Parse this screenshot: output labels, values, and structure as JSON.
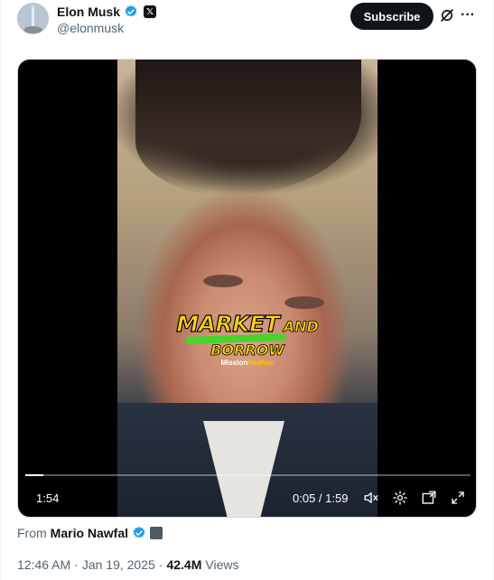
{
  "author": {
    "display_name": "Elon Musk",
    "handle": "@elonmusk",
    "x_badge": "𝕏"
  },
  "header": {
    "subscribe_label": "Subscribe",
    "more_label": "···"
  },
  "video": {
    "caption_word1": "MARKET",
    "caption_word2": "AND",
    "caption_word3": "BORROW",
    "watermark_part1": "Mission",
    "watermark_part2": "Radhne",
    "elapsed_badge": "1:54",
    "time_display": "0:05 / 1:59",
    "progress": 0.04
  },
  "source": {
    "from_label": "From",
    "name": "Mario Nawfal"
  },
  "meta": {
    "time": "12:46 AM",
    "separator": "·",
    "date": "Jan 19, 2025",
    "views_count": "42.4M",
    "views_label": "Views"
  },
  "colors": {
    "verified_blue": "#1d9bf0",
    "subscribe_bg": "#0f1419",
    "secondary_text": "#536471"
  },
  "icons": {
    "verified": "verified-badge-icon",
    "grok": "grok-icon",
    "more": "more-icon",
    "mute": "volume-muted-icon",
    "settings": "gear-icon",
    "pip": "picture-in-picture-icon",
    "fullscreen": "fullscreen-icon"
  }
}
